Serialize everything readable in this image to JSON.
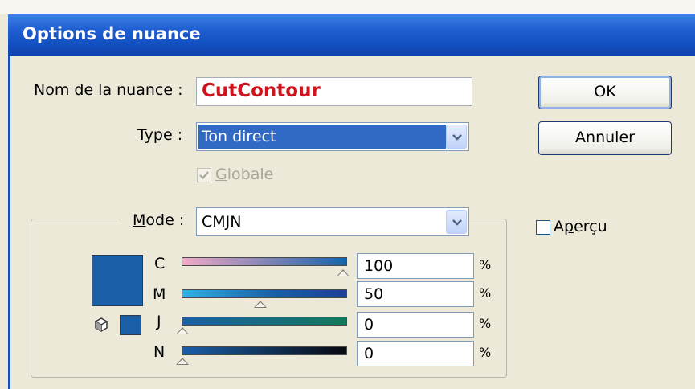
{
  "dialog": {
    "title": "Options de nuance",
    "name_label_u": "N",
    "name_label_rest": "om de la nuance :",
    "name_value": "CutContour",
    "type_label_u": "T",
    "type_label_rest": "ype :",
    "type_value": "Ton direct",
    "globale_label_u": "G",
    "globale_label_rest": "lobale",
    "globale_checked": true,
    "mode_label_u": "M",
    "mode_label_rest": "ode :",
    "mode_value": "CMJN",
    "ok_label": "OK",
    "cancel_label": "Annuler",
    "apercu_label_pre": "A",
    "apercu_label_u": "p",
    "apercu_label_rest": "erçu",
    "apercu_checked": false,
    "swatch_color": "#1a5fa8",
    "channels": [
      {
        "letter": "C",
        "value": "100",
        "unit": "%"
      },
      {
        "letter": "M",
        "value": "50",
        "unit": "%"
      },
      {
        "letter": "J",
        "value": "0",
        "unit": "%"
      },
      {
        "letter": "N",
        "value": "0",
        "unit": "%"
      }
    ],
    "icons": [
      "checkmark-icon",
      "dropdown-arrow-icon",
      "out-of-gamut-cube-icon",
      "slider-thumb-icon"
    ]
  }
}
